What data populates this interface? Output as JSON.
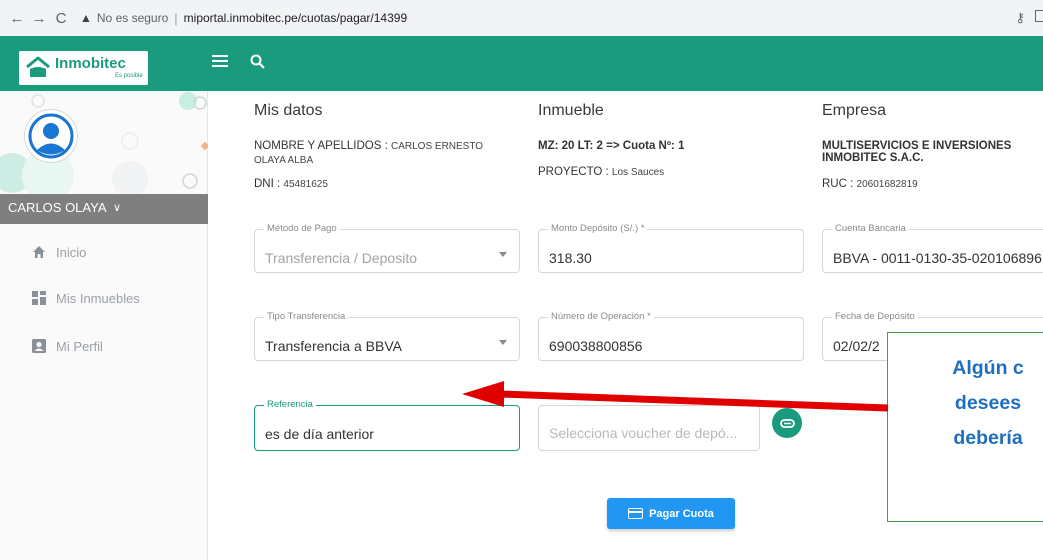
{
  "browser": {
    "insecure_label": "No es seguro",
    "url": "miportal.inmobitec.pe/cuotas/pagar/14399"
  },
  "brand": {
    "name": "Inmobitec",
    "tagline": "Es posible",
    "accent": "#1a9b7d"
  },
  "sidebar": {
    "user_name": "CARLOS OLAYA",
    "items": [
      {
        "label": "Inicio",
        "icon": "home-icon"
      },
      {
        "label": "Mis Inmuebles",
        "icon": "grid-icon"
      },
      {
        "label": "Mi Perfil",
        "icon": "profile-icon"
      }
    ]
  },
  "mis_datos": {
    "title": "Mis datos",
    "name_label": "NOMBRE Y APELLIDOS :",
    "name_value_1": "CARLOS ERNESTO",
    "name_value_2": "OLAYA ALBA",
    "dni_label": "DNI :",
    "dni_value": "45481625"
  },
  "inmueble": {
    "title": "Inmueble",
    "lot": "MZ: 20 LT: 2 => Cuota Nº: 1",
    "project_label": "PROYECTO :",
    "project_value": "Los Sauces"
  },
  "empresa": {
    "title": "Empresa",
    "name_1": "MULTISERVICIOS E INVERSIONES",
    "name_2": "INMOBITEC S.A.C.",
    "ruc_label": "RUC :",
    "ruc_value": "20601682819"
  },
  "form": {
    "metodo_label": "Método de Pago",
    "metodo_value": "Transferencia / Deposito",
    "monto_label": "Monto Depósito (S/.) *",
    "monto_value": "318.30",
    "cuenta_label": "Cuenta Bancaria",
    "cuenta_value": "BBVA - 0011-0130-35-020106896",
    "tipo_label": "Tipo Transferencia",
    "tipo_value": "Transferencia a BBVA",
    "operacion_label": "Número de Operación *",
    "operacion_value": "690038800856",
    "fecha_label": "Fecha de Depósito",
    "fecha_value": "02/02/2",
    "referencia_label": "Referencia",
    "referencia_value": "es de día anterior",
    "voucher_placeholder": "Selecciona voucher de depó...",
    "pay_button": "Pagar Cuota"
  },
  "annotation": {
    "line1": "Algún c",
    "line2": "desees",
    "line3": "debería",
    "text_color": "#1e6fc2",
    "arrow_color": "#e00000"
  }
}
